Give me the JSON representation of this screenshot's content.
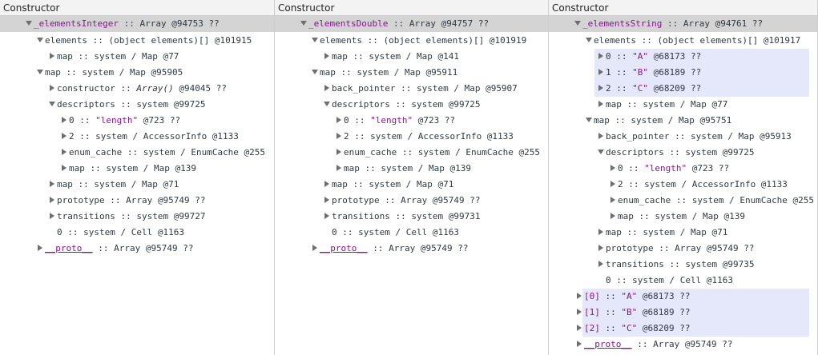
{
  "panels": [
    {
      "header": "Constructor",
      "rows": [
        {
          "tw": "down",
          "key": "_elementsInteger",
          "keyStyle": "purple",
          "rest": " :: Array @94753 ??",
          "indent": 0,
          "sel": true
        },
        {
          "tw": "down",
          "key": "elements",
          "rest": " :: (object elements)[] @101915",
          "indent": 1
        },
        {
          "tw": "right",
          "key": "map",
          "rest": " :: system / Map @77",
          "indent": 2
        },
        {
          "tw": "down",
          "key": "map",
          "rest": " :: system / Map @95905",
          "indent": 1
        },
        {
          "tw": "right",
          "key": "constructor",
          "rest": " :: ",
          "italic": "Array()",
          "rest2": " @94045 ??",
          "indent": 2
        },
        {
          "tw": "down",
          "key": "descriptors",
          "rest": " :: system @99725",
          "indent": 2
        },
        {
          "tw": "right",
          "key": "0",
          "rest": " :: ",
          "str": "\"length\"",
          "rest2": " @723 ??",
          "indent": 3
        },
        {
          "tw": "right",
          "key": "2",
          "rest": " :: system / AccessorInfo @1133",
          "indent": 3
        },
        {
          "tw": "right",
          "key": "enum_cache",
          "rest": " :: system / EnumCache @255",
          "indent": 3
        },
        {
          "tw": "right",
          "key": "map",
          "rest": " :: system / Map @139",
          "indent": 3
        },
        {
          "tw": "right",
          "key": "map",
          "rest": " :: system / Map @71",
          "indent": 2
        },
        {
          "tw": "right",
          "key": "prototype",
          "rest": " :: Array @95749 ??",
          "indent": 2
        },
        {
          "tw": "right",
          "key": "transitions",
          "rest": " :: system @99727",
          "indent": 2
        },
        {
          "tw": "none",
          "key": "0",
          "rest": " :: system / Cell @1163",
          "indent": 2
        },
        {
          "tw": "right",
          "key": "__proto__",
          "keyStyle": "ul",
          "rest": " :: Array @95749 ??",
          "indent": 1
        }
      ]
    },
    {
      "header": "Constructor",
      "rows": [
        {
          "tw": "down",
          "key": "_elementsDouble",
          "keyStyle": "purple",
          "rest": " :: Array @94757 ??",
          "indent": 0,
          "sel": true
        },
        {
          "tw": "down",
          "key": "elements",
          "rest": " :: (object elements)[] @101919",
          "indent": 1
        },
        {
          "tw": "right",
          "key": "map",
          "rest": " :: system / Map @141",
          "indent": 2
        },
        {
          "tw": "down",
          "key": "map",
          "rest": " :: system / Map @95911",
          "indent": 1
        },
        {
          "tw": "right",
          "key": "back_pointer",
          "rest": " :: system / Map @95907",
          "indent": 2
        },
        {
          "tw": "down",
          "key": "descriptors",
          "rest": " :: system @99725",
          "indent": 2
        },
        {
          "tw": "right",
          "key": "0",
          "rest": " :: ",
          "str": "\"length\"",
          "rest2": " @723 ??",
          "indent": 3
        },
        {
          "tw": "right",
          "key": "2",
          "rest": " :: system / AccessorInfo @1133",
          "indent": 3
        },
        {
          "tw": "right",
          "key": "enum_cache",
          "rest": " :: system / EnumCache @255",
          "indent": 3
        },
        {
          "tw": "right",
          "key": "map",
          "rest": " :: system / Map @139",
          "indent": 3
        },
        {
          "tw": "right",
          "key": "map",
          "rest": " :: system / Map @71",
          "indent": 2
        },
        {
          "tw": "right",
          "key": "prototype",
          "rest": " :: Array @95749 ??",
          "indent": 2
        },
        {
          "tw": "right",
          "key": "transitions",
          "rest": " :: system @99731",
          "indent": 2
        },
        {
          "tw": "none",
          "key": "0",
          "rest": " :: system / Cell @1163",
          "indent": 2
        },
        {
          "tw": "right",
          "key": "__proto__",
          "keyStyle": "ul",
          "rest": " :: Array @95749 ??",
          "indent": 1
        }
      ]
    },
    {
      "header": "Constructor",
      "highlights": [
        [
          3,
          5
        ],
        [
          18,
          20
        ]
      ],
      "rows": [
        {
          "tw": "down",
          "key": "_elementsString",
          "keyStyle": "purple",
          "rest": " :: Array @94761 ??",
          "indent": 0,
          "sel": true
        },
        {
          "tw": "down",
          "key": "elements",
          "rest": " :: (object elements)[] @101917",
          "indent": 1
        },
        {
          "tw": "right",
          "key": "0",
          "rest": " :: ",
          "str": "\"A\"",
          "rest2": " @68173 ??",
          "indent": 2
        },
        {
          "tw": "right",
          "key": "1",
          "rest": " :: ",
          "str": "\"B\"",
          "rest2": " @68189 ??",
          "indent": 2
        },
        {
          "tw": "right",
          "key": "2",
          "rest": " :: ",
          "str": "\"C\"",
          "rest2": " @68209 ??",
          "indent": 2
        },
        {
          "tw": "right",
          "key": "map",
          "rest": " :: system / Map @77",
          "indent": 2
        },
        {
          "tw": "down",
          "key": "map",
          "rest": " :: system / Map @95751",
          "indent": 1
        },
        {
          "tw": "right",
          "key": "back_pointer",
          "rest": " :: system / Map @95913",
          "indent": 2
        },
        {
          "tw": "down",
          "key": "descriptors",
          "rest": " :: system @99725",
          "indent": 2
        },
        {
          "tw": "right",
          "key": "0",
          "rest": " :: ",
          "str": "\"length\"",
          "rest2": " @723 ??",
          "indent": 3
        },
        {
          "tw": "right",
          "key": "2",
          "rest": " :: system / AccessorInfo @1133",
          "indent": 3
        },
        {
          "tw": "right",
          "key": "enum_cache",
          "rest": " :: system / EnumCache @255",
          "indent": 3
        },
        {
          "tw": "right",
          "key": "map",
          "rest": " :: system / Map @139",
          "indent": 3
        },
        {
          "tw": "right",
          "key": "map",
          "rest": " :: system / Map @71",
          "indent": 2
        },
        {
          "tw": "right",
          "key": "prototype",
          "rest": " :: Array @95749 ??",
          "indent": 2
        },
        {
          "tw": "right",
          "key": "transitions",
          "rest": " :: system @99735",
          "indent": 2
        },
        {
          "tw": "none",
          "key": "0",
          "rest": " :: system / Cell @1163",
          "indent": 2
        },
        {
          "tw": "right",
          "key": "[0]",
          "keyStyle": "purple",
          "rest": " :: ",
          "str": "\"A\"",
          "rest2": " @68173 ??",
          "indent": 0
        },
        {
          "tw": "right",
          "key": "[1]",
          "keyStyle": "purple",
          "rest": " :: ",
          "str": "\"B\"",
          "rest2": " @68189 ??",
          "indent": 0
        },
        {
          "tw": "right",
          "key": "[2]",
          "keyStyle": "purple",
          "rest": " :: ",
          "str": "\"C\"",
          "rest2": " @68209 ??",
          "indent": 0
        },
        {
          "tw": "right",
          "key": "__proto__",
          "keyStyle": "ul",
          "rest": " :: Array @95749 ??",
          "indent": 1
        }
      ]
    }
  ]
}
